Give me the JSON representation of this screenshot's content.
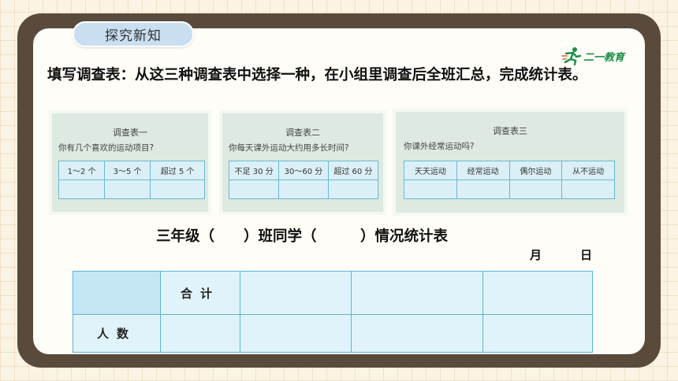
{
  "tab_label": "探究新知",
  "logo": {
    "text": "二一教育"
  },
  "instruction": "填写调查表：从这三种调查表中选择一种，在小组里调查后全班汇总，完成统计表。",
  "survey_cards": [
    {
      "title": "调查表一",
      "question": "你有几个喜欢的运动项目?",
      "options": [
        "1～2 个",
        "3～5 个",
        "超过 5 个"
      ]
    },
    {
      "title": "调查表二",
      "question": "你每天课外运动大约用多长时间?",
      "options": [
        "不足 30 分",
        "30～60 分",
        "超过 60 分"
      ]
    },
    {
      "title": "调查表三",
      "question": "你课外经常运动吗?",
      "options": [
        "天天运动",
        "经常运动",
        "偶尔运动",
        "从不运动"
      ]
    }
  ],
  "stats_table": {
    "title": "三年级（　　）班同学（　　　）情况统计表",
    "month_label": "月",
    "day_label": "日",
    "total_label": "合计",
    "people_label": "人数"
  }
}
